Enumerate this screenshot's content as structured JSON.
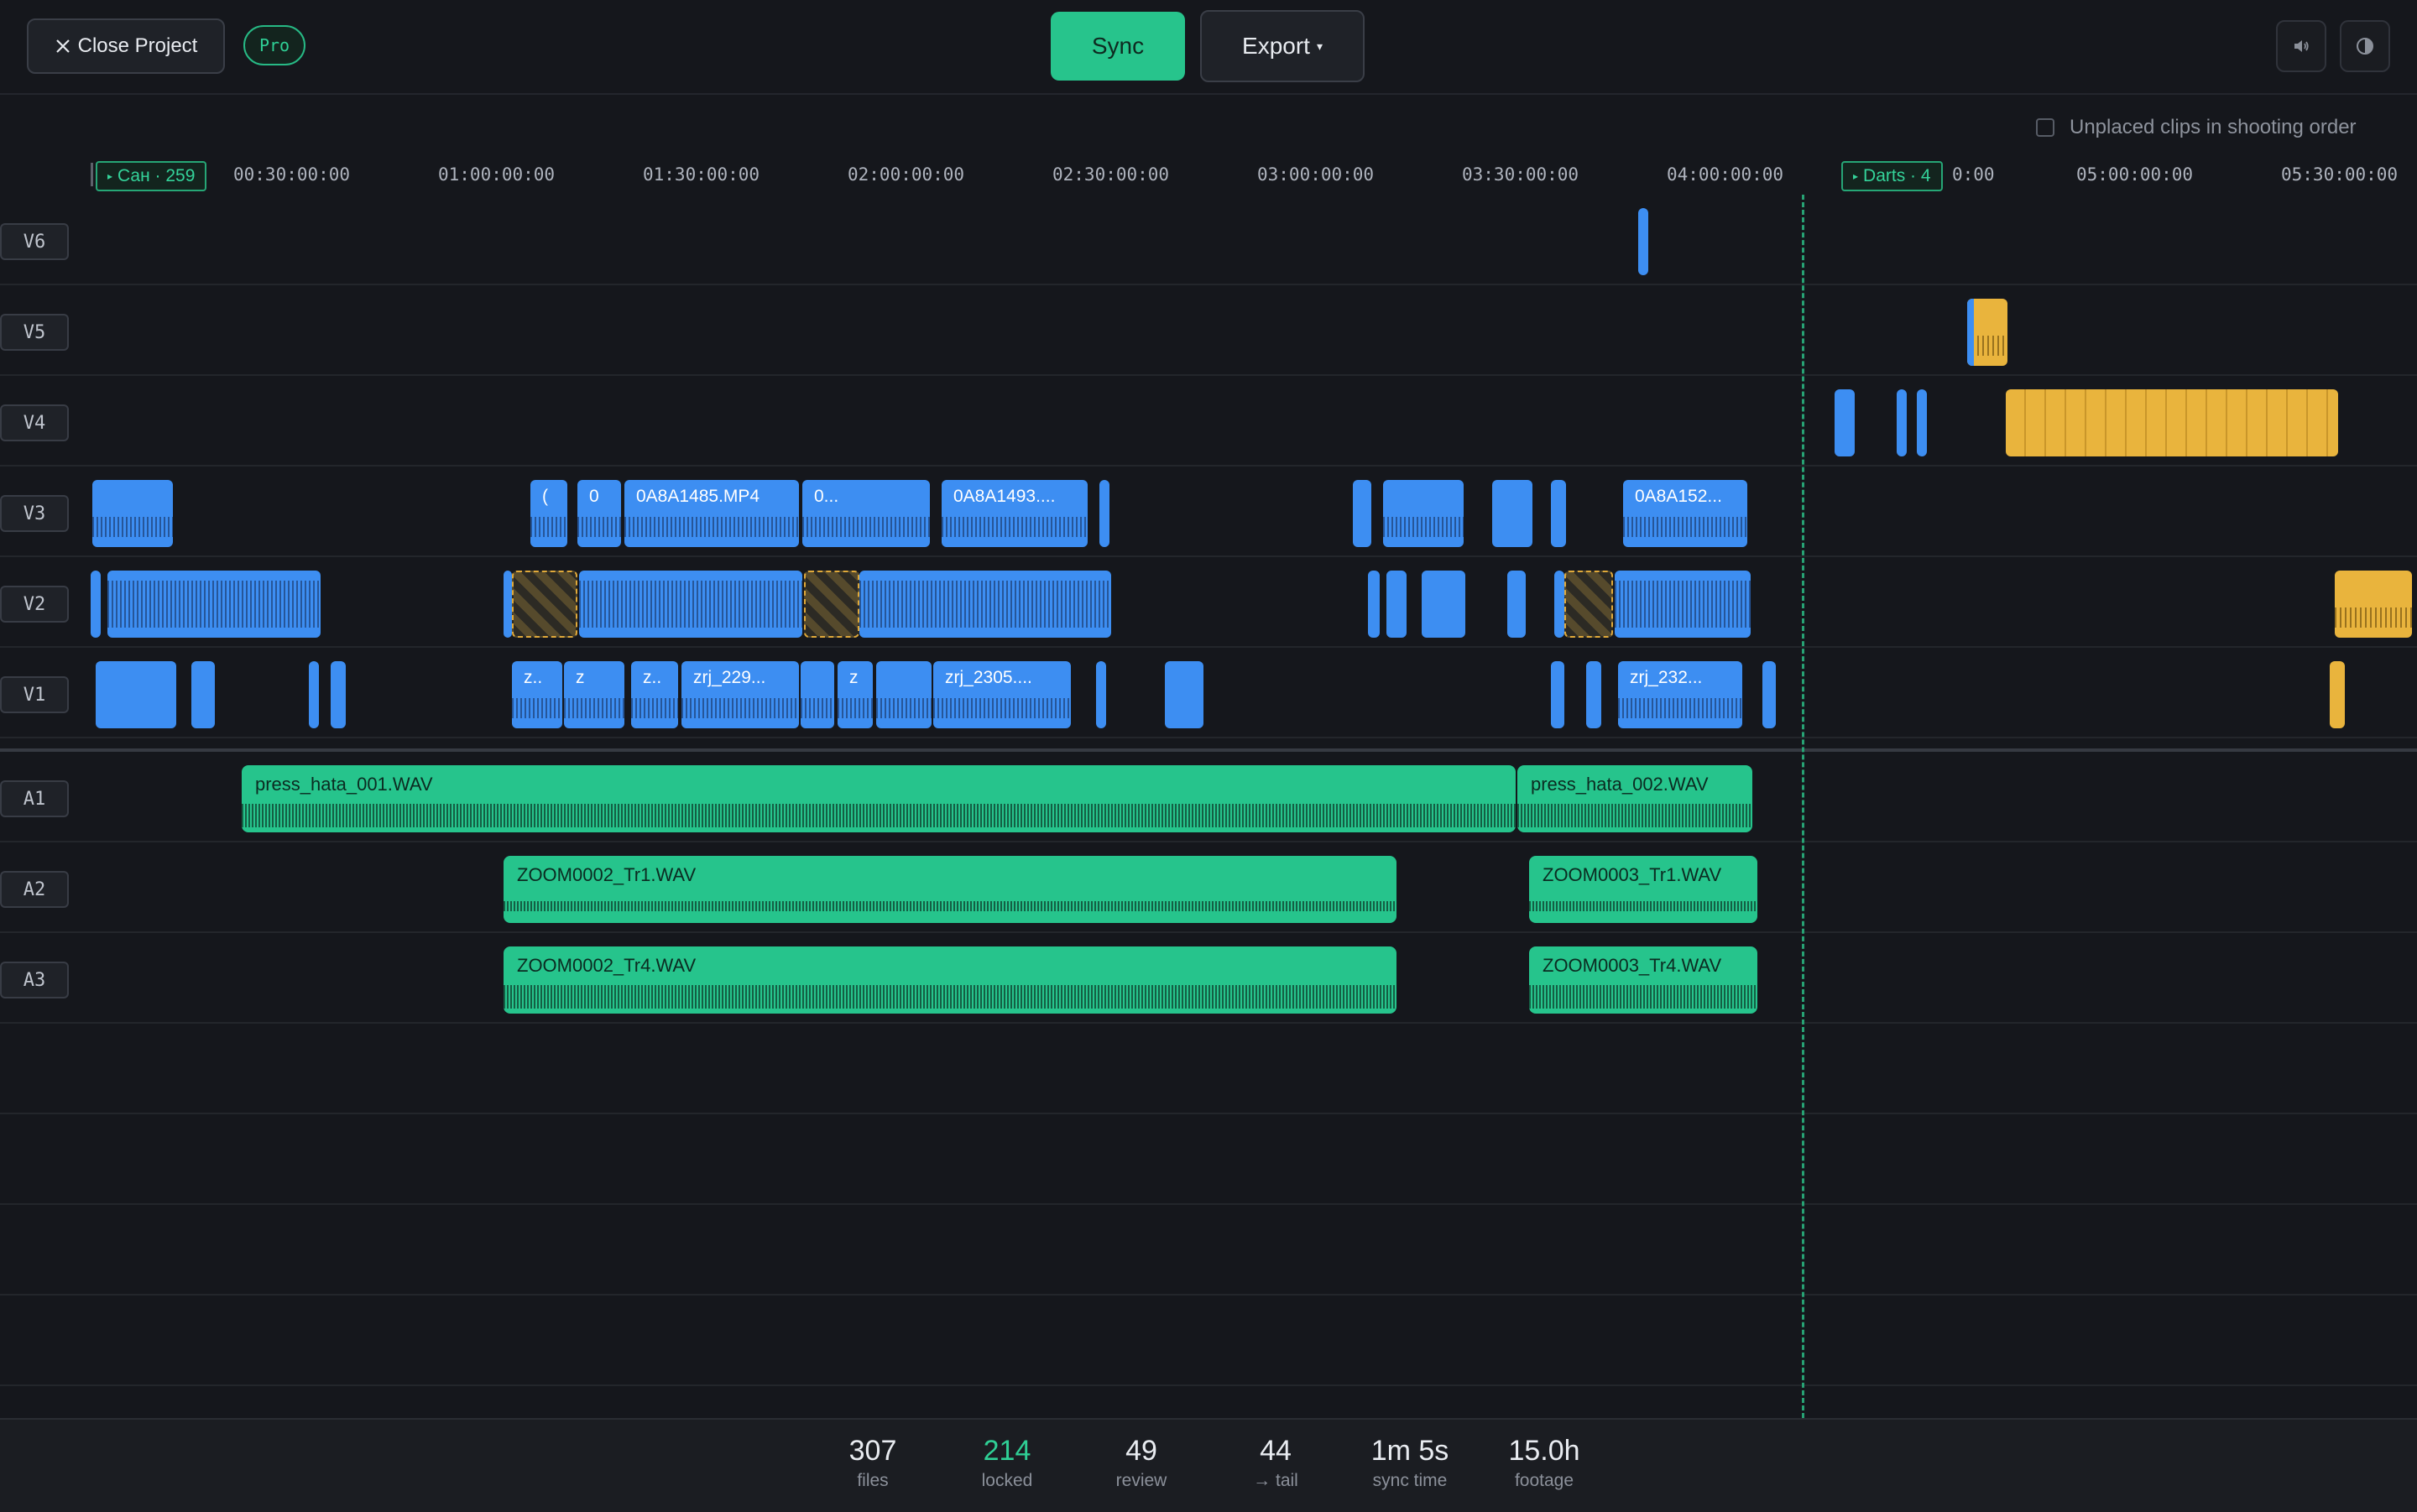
{
  "toolbar": {
    "close_label": "Close Project",
    "pro_label": "Pro",
    "sync_label": "Sync",
    "export_label": "Export",
    "export_caret": "▾",
    "volume_icon": "speaker-icon",
    "theme_icon": "contrast-icon"
  },
  "options": {
    "unplaced_label": "Unplaced clips in shooting order",
    "unplaced_checked": false
  },
  "ruler": {
    "ticks": [
      "00:30:00:00",
      "01:00:00:00",
      "01:30:00:00",
      "02:00:00:00",
      "02:30:00:00",
      "03:00:00:00",
      "03:30:00:00",
      "04:00:00:00",
      "0:00",
      "05:00:00:00",
      "05:30:00:00"
    ],
    "markers": [
      "Сан · 259",
      "Darts · 4"
    ]
  },
  "tracks": {
    "video": [
      "V6",
      "V5",
      "V4",
      "V3",
      "V2",
      "V1"
    ],
    "audio": [
      "A1",
      "A2",
      "A3"
    ]
  },
  "clip_labels": {
    "v3_a": "0A8A1485.MP4",
    "v3_b": "0...",
    "v3_c": "0A8A1493....",
    "v3_d": "0A8A152...",
    "v3_e": "(",
    "v3_f": "0",
    "v1_a": "z..",
    "v1_b": "z",
    "v1_c": "z..",
    "v1_d": "zrj_229...",
    "v1_e": "z",
    "v1_f": "zrj_2305....",
    "v1_g": "zrj_232...",
    "a1_a": "press_hata_001.WAV",
    "a1_b": "press_hata_002.WAV",
    "a2_a": "ZOOM0002_Tr1.WAV",
    "a2_b": "ZOOM0003_Tr1.WAV",
    "a3_a": "ZOOM0002_Tr4.WAV",
    "a3_b": "ZOOM0003_Tr4.WAV"
  },
  "stats": [
    {
      "value": "307",
      "label": "files"
    },
    {
      "value": "214",
      "label": "locked"
    },
    {
      "value": "49",
      "label": "review"
    },
    {
      "value": "44",
      "label": "→ tail"
    },
    {
      "value": "1m 5s",
      "label": "sync time"
    },
    {
      "value": "15.0h",
      "label": "footage"
    }
  ],
  "colors": {
    "video_clip": "#3d8ef2",
    "audio_clip": "#26c48c",
    "offset_clip": "#e9b43d",
    "accent": "#2fcf95"
  }
}
